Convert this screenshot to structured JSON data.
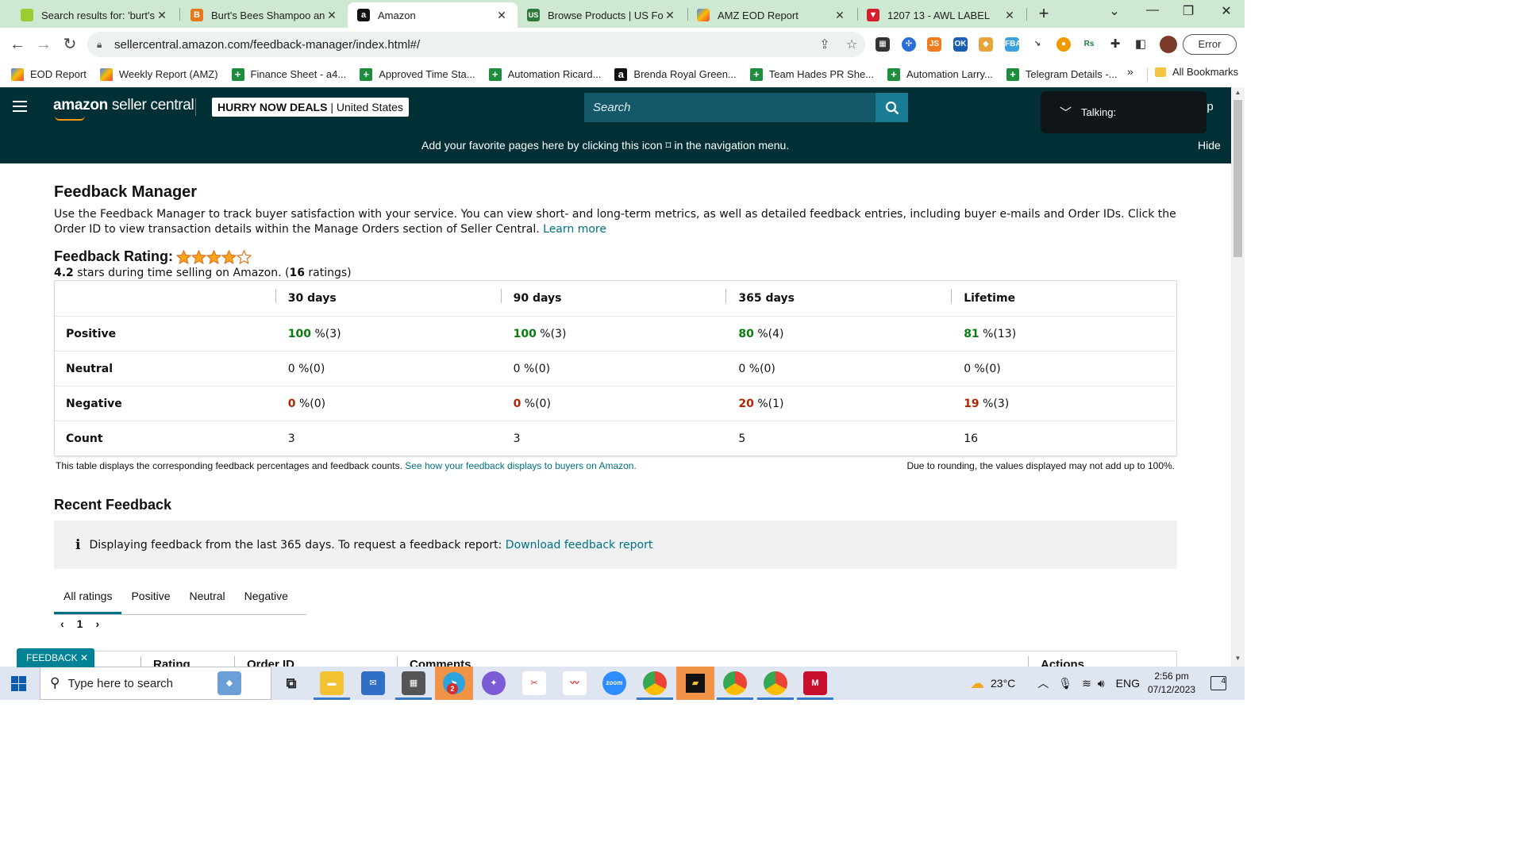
{
  "browser": {
    "tabs": [
      {
        "title": "Search results for: 'burt's b",
        "active": false
      },
      {
        "title": "Burt's Bees Shampoo and V",
        "active": false
      },
      {
        "title": "Amazon",
        "active": true
      },
      {
        "title": "Browse Products | US Food",
        "active": false
      },
      {
        "title": "AMZ EOD Report",
        "active": false
      },
      {
        "title": "1207 13 - AWL LABEL",
        "active": false
      }
    ],
    "url": "sellercentral.amazon.com/feedback-manager/index.html#/",
    "profile_status": "Error",
    "bookmarks": [
      "EOD Report",
      "Weekly Report (AMZ)",
      "Finance Sheet - a4...",
      "Approved Time Sta...",
      "Automation Ricard...",
      "Brenda Royal Green...",
      "Team Hades PR She...",
      "Automation Larry...",
      "Telegram Details -..."
    ],
    "bookmarks_more": "»",
    "all_bookmarks": "All Bookmarks"
  },
  "header": {
    "logo_bold": "amazon",
    "logo_rest": " seller central",
    "store_name": "HURRY NOW DEALS",
    "store_region": " | United States",
    "search_placeholder": "Search",
    "talking_label": "Talking:",
    "help_peek": "lp",
    "favorites_msg": "Add your favorite pages here by clicking this icon ⌑ in the navigation menu.",
    "hide_label": "Hide"
  },
  "page": {
    "title": "Feedback Manager",
    "intro": "Use the Feedback Manager to track buyer satisfaction with your service. You can view short- and long-term metrics, as well as detailed feedback entries, including buyer e-mails and Order IDs. Click the Order ID to view transaction details within the Manage Orders section of Seller Central.",
    "learn_more": "Learn more",
    "rating_label": "Feedback Rating:",
    "stars_filled": 4,
    "stars_total": 5,
    "rating_value": "4.2",
    "rating_text_a": " stars during time selling on Amazon. (",
    "rating_count": "16",
    "rating_text_b": " ratings)"
  },
  "feedback_table": {
    "columns": [
      "30 days",
      "90 days",
      "365 days",
      "Lifetime"
    ],
    "rows": [
      {
        "label": "Positive",
        "kind": "pos",
        "cells": [
          {
            "pct": "100",
            "rest": " %(3)"
          },
          {
            "pct": "100",
            "rest": " %(3)"
          },
          {
            "pct": "80",
            "rest": " %(4)"
          },
          {
            "pct": "81",
            "rest": " %(13)"
          }
        ]
      },
      {
        "label": "Neutral",
        "kind": "neu",
        "cells": [
          {
            "pct": "0",
            "rest": " %(0)"
          },
          {
            "pct": "0",
            "rest": " %(0)"
          },
          {
            "pct": "0",
            "rest": " %(0)"
          },
          {
            "pct": "0",
            "rest": " %(0)"
          }
        ]
      },
      {
        "label": "Negative",
        "kind": "neg",
        "cells": [
          {
            "pct": "0",
            "rest": " %(0)"
          },
          {
            "pct": "0",
            "rest": " %(0)"
          },
          {
            "pct": "20",
            "rest": " %(1)"
          },
          {
            "pct": "19",
            "rest": " %(3)"
          }
        ]
      },
      {
        "label": "Count",
        "kind": "count",
        "cells": [
          {
            "pct": "",
            "rest": "3"
          },
          {
            "pct": "",
            "rest": "3"
          },
          {
            "pct": "",
            "rest": "5"
          },
          {
            "pct": "",
            "rest": "16"
          }
        ]
      }
    ],
    "note": "This table displays the corresponding feedback percentages and feedback counts.",
    "note_link": "See how your feedback displays to buyers on Amazon.",
    "rounding_note": "Due to rounding, the values displayed may not add up to 100%."
  },
  "recent": {
    "title": "Recent Feedback",
    "info_text": "Displaying feedback from the last 365 days. To request a feedback report:",
    "info_link": "Download feedback report",
    "tabs": [
      "All ratings",
      "Positive",
      "Neutral",
      "Negative"
    ],
    "active_tab": 0,
    "page": "1",
    "columns": [
      ".",
      "Rating",
      "Order ID",
      "Comments",
      "Actions"
    ],
    "feedback_chip": "FEEDBACK ✕"
  },
  "taskbar": {
    "search_placeholder": "Type here to search",
    "weather": "23°C",
    "language": "ENG",
    "time": "2:56 pm",
    "date": "07/12/2023",
    "notifications": "4",
    "mail_badge": "2"
  },
  "colors": {
    "amazon_header": "#002f36",
    "positive": "#067d0e",
    "negative": "#b12704",
    "link": "#007185",
    "star": "#ffa41c"
  }
}
